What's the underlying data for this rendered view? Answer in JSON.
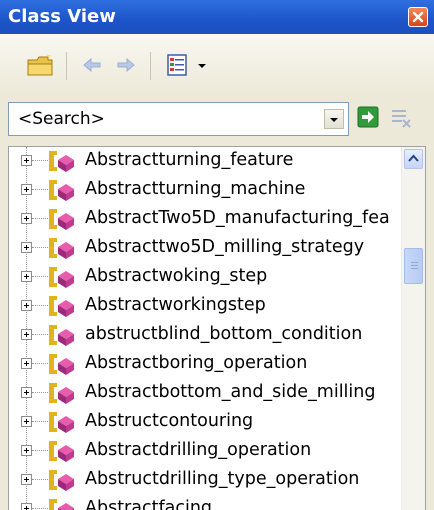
{
  "window": {
    "title": "Class View"
  },
  "toolbar": {
    "icons": [
      "folder-icon",
      "back-arrow-icon",
      "forward-arrow-icon",
      "class-view-settings-icon",
      "dropdown-arrow-icon"
    ]
  },
  "search": {
    "value": "<Search>"
  },
  "tree": {
    "items": [
      {
        "label": "Abstractturning_feature"
      },
      {
        "label": "Abstractturning_machine"
      },
      {
        "label": "AbstractTwo5D_manufacturing_fea"
      },
      {
        "label": "Abstracttwo5D_milling_strategy"
      },
      {
        "label": "Abstractwoking_step"
      },
      {
        "label": "Abstractworkingstep"
      },
      {
        "label": "abstructblind_bottom_condition"
      },
      {
        "label": "Abstractboring_operation"
      },
      {
        "label": "Abstractbottom_and_side_milling"
      },
      {
        "label": "Abstructcontouring"
      },
      {
        "label": "Abstractdrilling_operation"
      },
      {
        "label": "Abstructdrilling_type_operation"
      },
      {
        "label": "Abstractfacing"
      }
    ]
  },
  "colors": {
    "titlebar": "#1d55c8",
    "close_button": "#d8431a",
    "window_bg": "#ece9d8",
    "tree_bg": "#ffffff",
    "scrollbar_thumb": "#b7cbf3"
  }
}
